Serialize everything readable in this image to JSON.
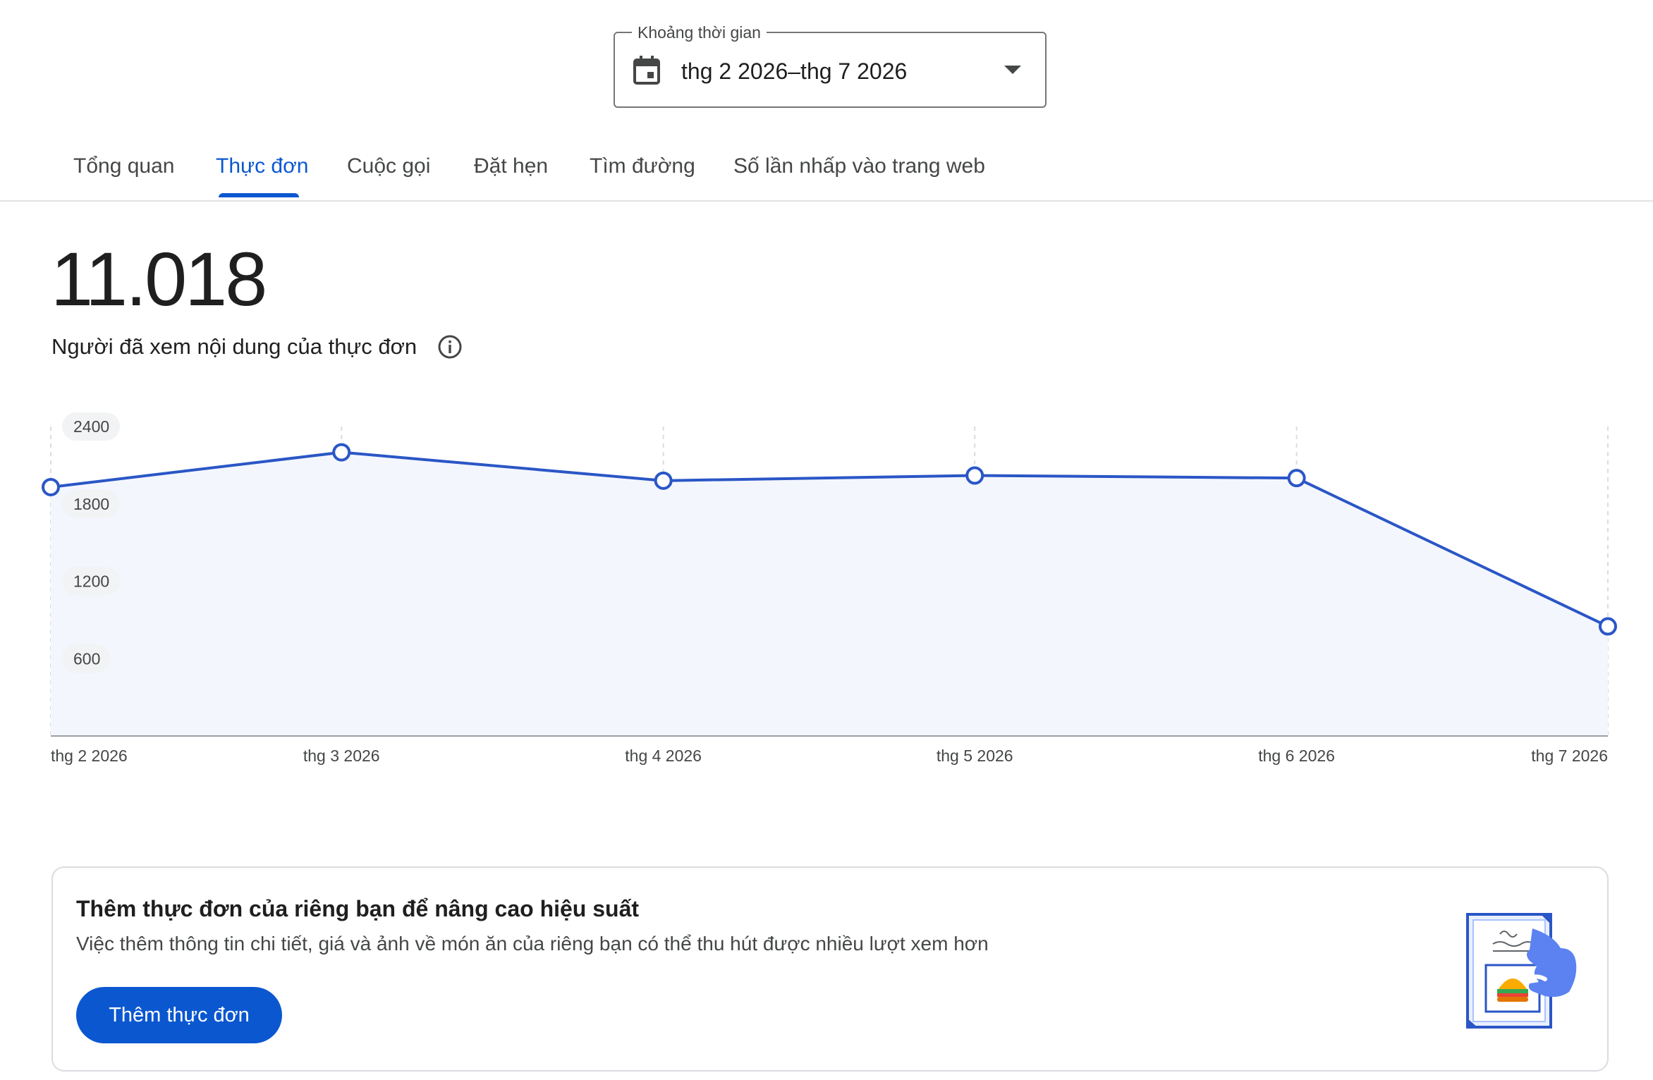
{
  "date_range": {
    "label": "Khoảng thời gian",
    "value": "thg 2 2026–thg 7 2026"
  },
  "tabs": [
    {
      "label": "Tổng quan",
      "active": false
    },
    {
      "label": "Thực đơn",
      "active": true
    },
    {
      "label": "Cuộc gọi",
      "active": false
    },
    {
      "label": "Đặt hẹn",
      "active": false
    },
    {
      "label": "Tìm đường",
      "active": false
    },
    {
      "label": "Số lần nhấp vào trang web",
      "active": false
    }
  ],
  "metric": {
    "value": "11.018",
    "label": "Người đã xem nội dung của thực đơn"
  },
  "chart_data": {
    "type": "area",
    "categories": [
      "thg 2 2026",
      "thg 3 2026",
      "thg 4 2026",
      "thg 5 2026",
      "thg 6 2026",
      "thg 7 2026"
    ],
    "values": [
      1930,
      2200,
      1980,
      2020,
      2000,
      850
    ],
    "ylim": [
      0,
      2400
    ],
    "yticks": [
      "600",
      "1200",
      "1800",
      "2400"
    ],
    "grid": true,
    "colors": {
      "line": "#2a56c6",
      "fill": "#f3f6fd",
      "grid": "#dadce0",
      "axis": "#9aa0a6",
      "tick_pill": "#f1f3f4",
      "tick_text": "#444746"
    }
  },
  "promo": {
    "title": "Thêm thực đơn của riêng bạn để nâng cao hiệu suất",
    "description": "Việc thêm thông tin chi tiết, giá và ảnh về món ăn của riêng bạn có thể thu hút được nhiều lượt xem hơn",
    "button_label": "Thêm thực đơn"
  },
  "colors": {
    "accent": "#0b57d0"
  }
}
